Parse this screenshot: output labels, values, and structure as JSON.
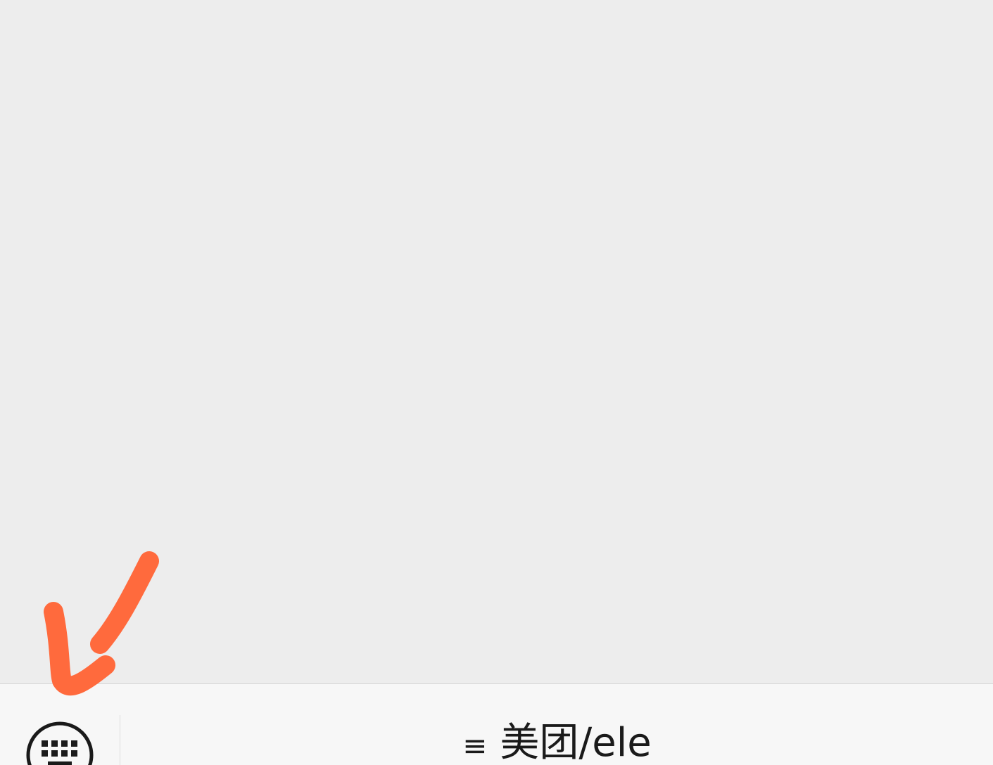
{
  "bottom_bar": {
    "keyboard_icon": "keyboard-toggle-icon",
    "menu": {
      "icon": "≡",
      "label": "美团/ele"
    }
  },
  "annotation": {
    "type": "checkmark",
    "color": "#ff6a3d"
  },
  "colors": {
    "background": "#ededed",
    "bottom_bar": "#f7f7f7",
    "text": "#1a1a1a"
  }
}
